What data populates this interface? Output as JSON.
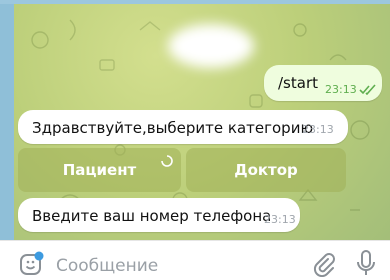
{
  "chat": {
    "messages": [
      {
        "direction": "outgoing",
        "text": "/start",
        "time": "23:13",
        "status": "read"
      },
      {
        "direction": "incoming",
        "text": "Здравствуйте,выберите категорию",
        "time": "23:13"
      },
      {
        "direction": "incoming",
        "text": "Введите ваш номер телефона",
        "time": "23:13"
      }
    ],
    "inline_keyboard": [
      {
        "label": "Пациент",
        "loading": true
      },
      {
        "label": "Доктор",
        "loading": false
      }
    ]
  },
  "composer": {
    "placeholder": "Сообщение"
  },
  "icons": {
    "emoji": "sticker-emoji-icon",
    "attach": "paperclip-icon",
    "mic": "microphone-icon",
    "read_receipt": "double-check-icon",
    "spinner": "loading-spinner-icon"
  },
  "colors": {
    "wallpaper": "#bccf7a",
    "outgoing_bubble": "#effdde",
    "incoming_bubble": "#ffffff",
    "read_check": "#5fae4f",
    "accent": "#3d9be0"
  }
}
